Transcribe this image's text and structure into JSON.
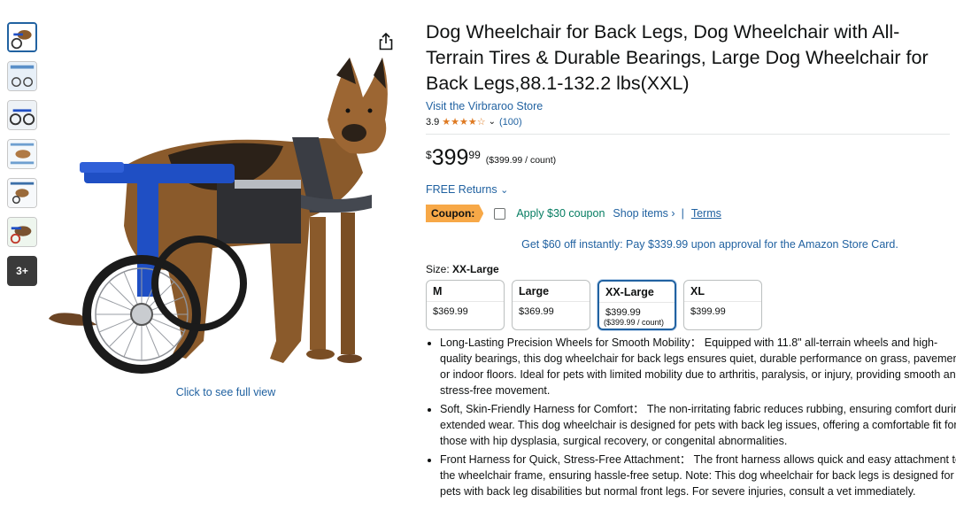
{
  "thumbnails": {
    "more_label": "3+"
  },
  "gallery": {
    "click_full_view": "Click to see full view"
  },
  "product": {
    "title": "Dog Wheelchair for Back Legs, Dog Wheelchair with All-Terrain Tires & Durable Bearings, Large Dog Wheelchair for Back Legs,88.1-132.2 lbs(XXL)",
    "store_link": "Visit the Virbraroo Store",
    "rating": "3.9",
    "stars": "★★★★☆",
    "rating_count": "(100)",
    "price_symbol": "$",
    "price_whole": "399",
    "price_fraction": "99",
    "unit_price": "($399.99 / count)",
    "free_returns": "FREE Returns",
    "coupon_badge": "Coupon:",
    "coupon_text": "Apply $30 coupon",
    "shop_items": "Shop items ›",
    "separator": "|",
    "terms": "Terms",
    "card_offer": "Get $60 off instantly: Pay $339.99 upon approval for the Amazon Store Card."
  },
  "size": {
    "label": "Size:",
    "selected": "XX-Large",
    "options": [
      {
        "name": "M",
        "price": "$369.99",
        "sub": ""
      },
      {
        "name": "Large",
        "price": "$369.99",
        "sub": ""
      },
      {
        "name": "XX-Large",
        "price": "$399.99",
        "sub": "($399.99 / count)"
      },
      {
        "name": "XL",
        "price": "$399.99",
        "sub": ""
      }
    ]
  },
  "bullets": [
    "Long-Lasting Precision Wheels for Smooth Mobility： Equipped with 11.8\" all-terrain wheels and high-quality bearings, this dog wheelchair for back legs ensures quiet, durable performance on grass, pavement, or indoor floors. Ideal for pets with limited mobility due to arthritis, paralysis, or injury, providing smooth and stress-free movement.",
    "Soft, Skin-Friendly Harness for Comfort： The non-irritating fabric reduces rubbing, ensuring comfort during extended wear. This dog wheelchair is designed for pets with back leg issues, offering a comfortable fit for those with hip dysplasia, surgical recovery, or congenital abnormalities.",
    "Front Harness for Quick, Stress-Free Attachment： The front harness allows quick and easy attachment to the wheelchair frame, ensuring hassle-free setup. Note: This dog wheelchair for back legs is designed for pets with back leg disabilities but normal front legs. For severe injuries, consult a vet immediately."
  ],
  "colors": {
    "link": "#2162a1",
    "star": "#de7921",
    "coupon_badge": "#f7a847",
    "coupon_text": "#067d62",
    "frame_blue": "#1f4fc4"
  }
}
